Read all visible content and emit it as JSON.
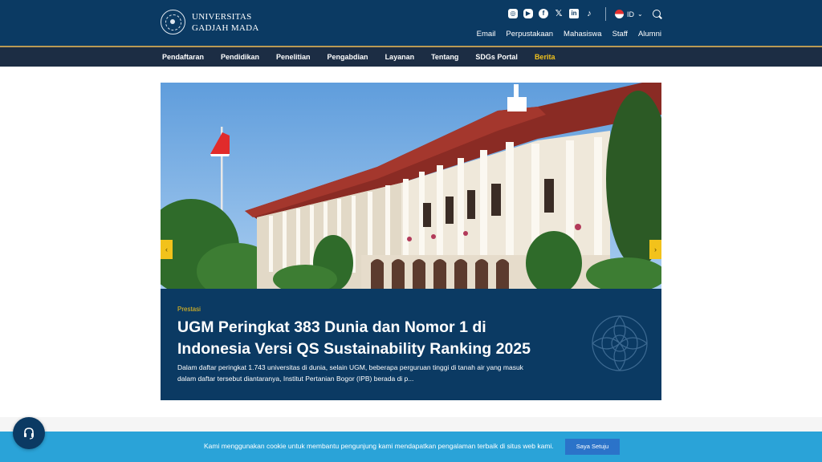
{
  "header": {
    "logo_line1": "UNIVERSITAS",
    "logo_line2": "GADJAH MADA",
    "socials": [
      "instagram-icon",
      "youtube-icon",
      "facebook-icon",
      "x-icon",
      "linkedin-icon",
      "tiktok-icon"
    ],
    "language": "ID",
    "utility_links": [
      "Email",
      "Perpustakaan",
      "Mahasiswa",
      "Staff",
      "Alumni"
    ]
  },
  "nav": {
    "items": [
      "Pendaftaran",
      "Pendidikan",
      "Penelitian",
      "Pengabdian",
      "Layanan",
      "Tentang",
      "SDGs Portal",
      "Berita"
    ],
    "active": "Berita"
  },
  "hero": {
    "category": "Prestasi",
    "title": "UGM Peringkat 383 Dunia dan Nomor 1 di Indonesia Versi QS Sustainability Ranking 2025",
    "excerpt": "Dalam daftar peringkat 1.743 universitas di dunia, selain UGM, beberapa perguruan tinggi di tanah air yang masuk dalam daftar tersebut diantaranya, Institut Pertanian Bogor (IPB) berada di p..."
  },
  "cookie": {
    "text": "Kami menggunakan cookie untuk membantu pengunjung kami mendapatkan pengalaman terbaik di situs web kami.",
    "button": "Saya Setuju"
  },
  "colors": {
    "primary": "#0b3a63",
    "accent": "#f2c21b",
    "cookie_bar": "#2aa3d8"
  }
}
